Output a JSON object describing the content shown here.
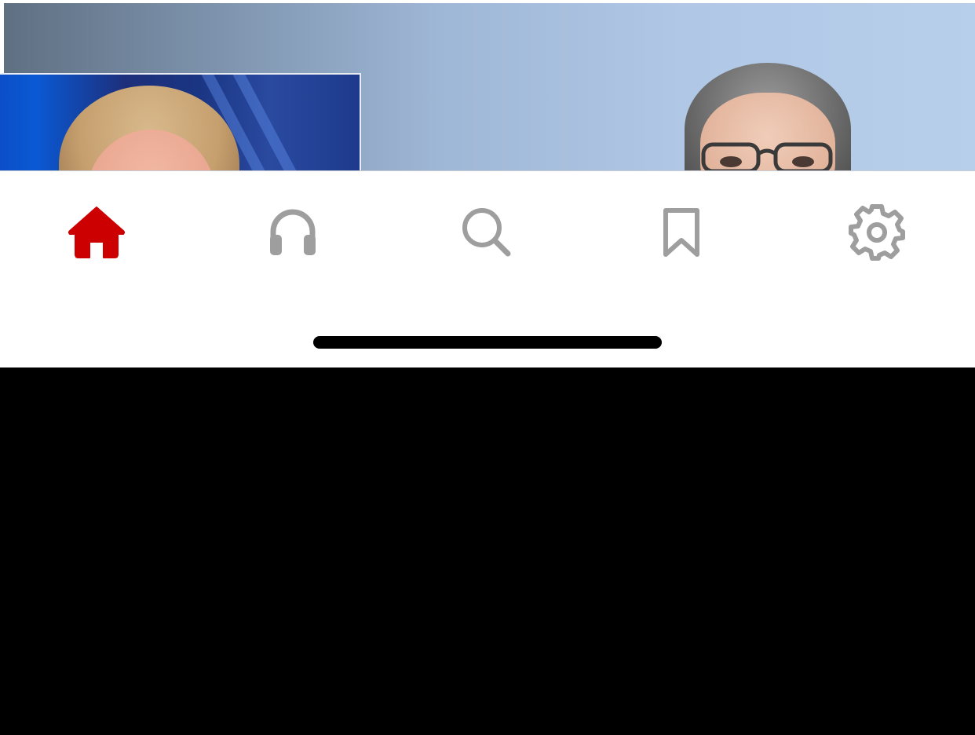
{
  "hero": {
    "image": "news-video-thumbnail-two-people"
  },
  "tabbar": {
    "active_color": "#cc0000",
    "inactive_color": "#9e9e9e",
    "background": "#ffffff",
    "items": [
      {
        "id": "home",
        "icon": "home-icon",
        "active": true
      },
      {
        "id": "listen",
        "icon": "headphones-icon",
        "active": false
      },
      {
        "id": "search",
        "icon": "search-icon",
        "active": false
      },
      {
        "id": "saved",
        "icon": "bookmark-icon",
        "active": false
      },
      {
        "id": "settings",
        "icon": "gear-icon",
        "active": false
      }
    ]
  },
  "system": {
    "home_indicator": "home-indicator-bar"
  }
}
